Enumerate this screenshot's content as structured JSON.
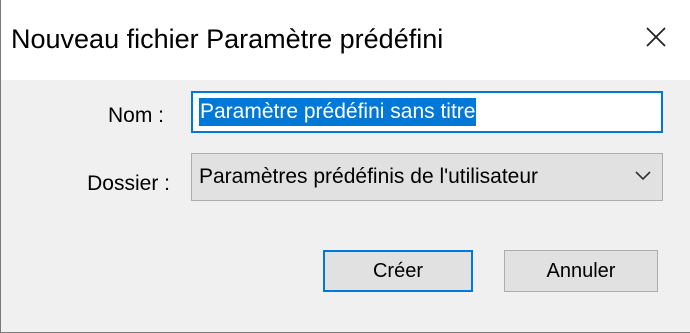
{
  "dialog": {
    "title": "Nouveau fichier Paramètre prédéfini",
    "close_icon": "close-icon"
  },
  "form": {
    "name_label": "Nom :",
    "name_value": "Paramètre prédéfini sans titre",
    "folder_label": "Dossier :",
    "folder_value": "Paramètres prédéfinis de l'utilisateur",
    "folder_icon": "chevron-down-icon"
  },
  "buttons": {
    "create_label": "Créer",
    "cancel_label": "Annuler"
  },
  "colors": {
    "accent": "#0078d7",
    "dialog_bg": "#f0f0f0",
    "button_bg": "#e1e1e1"
  }
}
